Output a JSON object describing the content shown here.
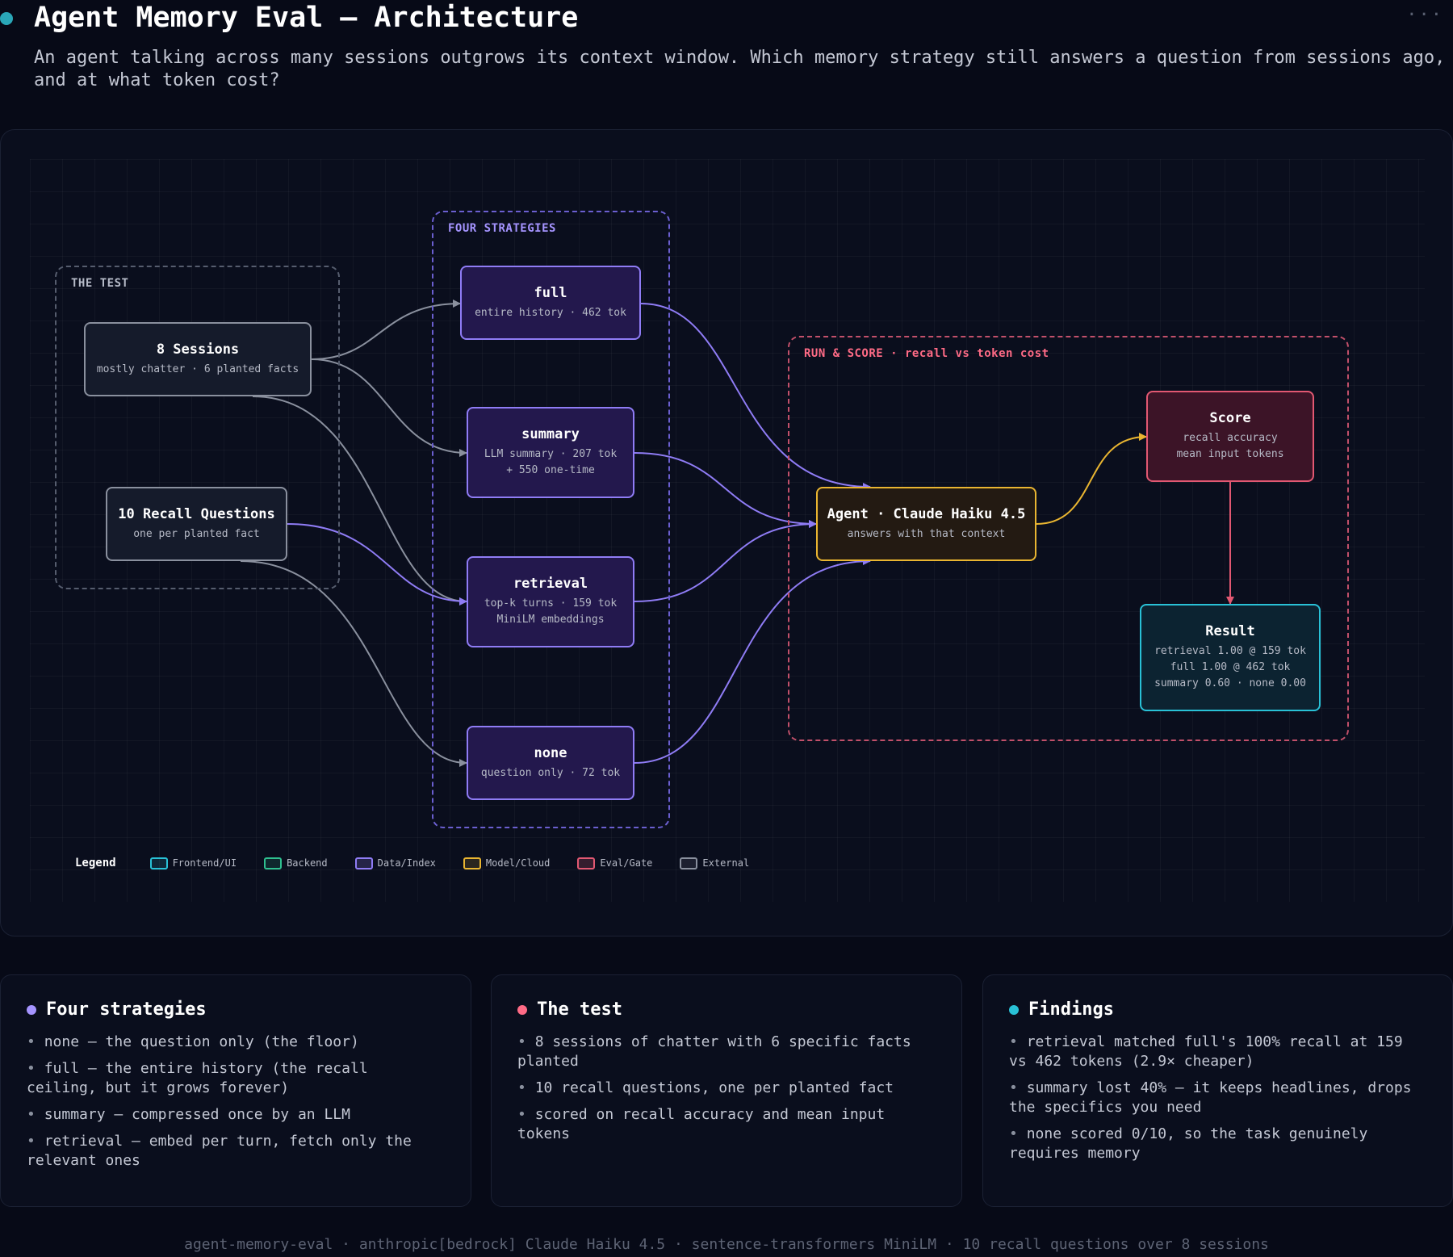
{
  "header": {
    "title": "Agent Memory Eval — Architecture",
    "subtitle": "An agent talking across many sessions outgrows its context window. Which memory strategy still answers a question from sessions ago, and at what token cost?",
    "more_icon": "ellipsis-icon"
  },
  "diagram": {
    "groups": {
      "test": "THE TEST",
      "strategies": "FOUR STRATEGIES",
      "run": "RUN & SCORE · recall vs token cost"
    },
    "nodes": {
      "sessions": {
        "title": "8 Sessions",
        "sub": "mostly chatter · 6 planted facts"
      },
      "questions": {
        "title": "10 Recall Questions",
        "sub": "one per planted fact"
      },
      "full": {
        "title": "full",
        "sub": "entire history · 462 tok"
      },
      "summary": {
        "title": "summary",
        "sub1": "LLM summary · 207 tok",
        "sub2": "+ 550 one-time"
      },
      "retrieval": {
        "title": "retrieval",
        "sub1": "top-k turns · 159 tok",
        "sub2": "MiniLM embeddings"
      },
      "none": {
        "title": "none",
        "sub": "question only · 72 tok"
      },
      "agent": {
        "title": "Agent · Claude Haiku 4.5",
        "sub": "answers with that context"
      },
      "score": {
        "title": "Score",
        "sub1": "recall accuracy",
        "sub2": "mean input tokens"
      },
      "result": {
        "title": "Result",
        "sub1": "retrieval 1.00 @ 159 tok",
        "sub2": "full 1.00 @ 462 tok",
        "sub3": "summary 0.60 · none 0.00"
      }
    },
    "legend": {
      "title": "Legend",
      "items": [
        {
          "label": "Frontend/UI",
          "color": "#29c1d6"
        },
        {
          "label": "Backend",
          "color": "#2fbf8f"
        },
        {
          "label": "Data/Index",
          "color": "#8f7cf5"
        },
        {
          "label": "Model/Cloud",
          "color": "#e9b531"
        },
        {
          "label": "Eval/Gate",
          "color": "#e25872"
        },
        {
          "label": "External",
          "color": "#8a909e"
        }
      ]
    }
  },
  "cards": {
    "strategies": {
      "title": "Four strategies",
      "dot_color": "#a594ff",
      "items": [
        "none — the question only (the floor)",
        "full — the entire history (the recall ceiling, but it grows forever)",
        "summary — compressed once by an LLM",
        "retrieval — embed per turn, fetch only the relevant ones"
      ]
    },
    "test": {
      "title": "The test",
      "dot_color": "#ff6b86",
      "items": [
        "8 sessions of chatter with 6 specific facts planted",
        "10 recall questions, one per planted fact",
        "scored on recall accuracy and mean input tokens"
      ]
    },
    "findings": {
      "title": "Findings",
      "dot_color": "#29c1d6",
      "items": [
        "retrieval matched full's 100% recall at 159 vs 462 tokens (2.9× cheaper)",
        "summary lost 40% — it keeps headlines, drops the specifics you need",
        "none scored 0/10, so the task genuinely requires memory"
      ]
    }
  },
  "footer": "agent-memory-eval · anthropic[bedrock] Claude Haiku 4.5 · sentence-transformers MiniLM · 10 recall questions over 8 sessions"
}
